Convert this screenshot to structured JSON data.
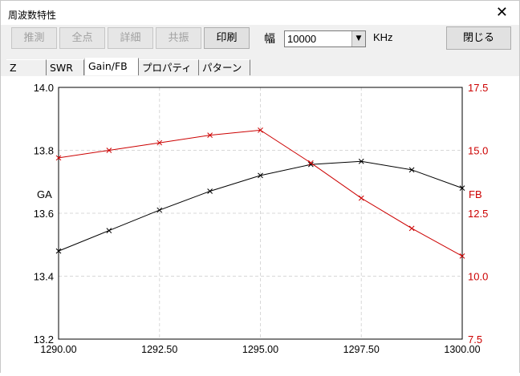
{
  "window": {
    "title": "周波数特性",
    "close_glyph": "✕"
  },
  "toolbar": {
    "buttons": [
      {
        "label": "推測",
        "enabled": false
      },
      {
        "label": "全点",
        "enabled": false
      },
      {
        "label": "詳細",
        "enabled": false
      },
      {
        "label": "共振",
        "enabled": false
      },
      {
        "label": "印刷",
        "enabled": true
      }
    ],
    "width_label": "幅",
    "width_value": "10000",
    "unit_label": "KHz",
    "close_button": "閉じる"
  },
  "tabs": [
    {
      "label": "Z",
      "active": false
    },
    {
      "label": "SWR",
      "active": false
    },
    {
      "label": "Gain/FB",
      "active": true
    },
    {
      "label": "プロパティ",
      "active": false
    },
    {
      "label": "パターン",
      "active": false
    }
  ],
  "colors": {
    "ga": "#000000",
    "fb": "#cc0000",
    "grid": "#d8d8d8"
  },
  "chart_data": {
    "type": "line",
    "xlabel": "",
    "x_ticks": [
      "1290.00",
      "1292.50",
      "1295.00",
      "1297.50",
      "1300.00"
    ],
    "xlim": [
      1290,
      1300
    ],
    "left_axis": {
      "label": "GA",
      "ylim": [
        13.2,
        14.0
      ],
      "ticks": [
        "13.2",
        "13.4",
        "13.6",
        "13.8",
        "14.0"
      ]
    },
    "right_axis": {
      "label": "FB",
      "ylim": [
        7.5,
        17.5
      ],
      "ticks": [
        "7.5",
        "10.0",
        "12.5",
        "15.0",
        "17.5"
      ]
    },
    "grid": true,
    "series": [
      {
        "name": "GA",
        "axis": "left",
        "x": [
          1290,
          1291.25,
          1292.5,
          1293.75,
          1295,
          1296.25,
          1297.5,
          1298.75,
          1300
        ],
        "values": [
          13.48,
          13.545,
          13.61,
          13.67,
          13.72,
          13.755,
          13.765,
          13.738,
          13.68
        ]
      },
      {
        "name": "FB",
        "axis": "right",
        "x": [
          1290,
          1291.25,
          1292.5,
          1293.75,
          1295,
          1296.25,
          1297.5,
          1298.75,
          1300
        ],
        "values": [
          14.7,
          15.0,
          15.3,
          15.6,
          15.8,
          14.5,
          13.1,
          11.9,
          10.8
        ]
      }
    ]
  }
}
